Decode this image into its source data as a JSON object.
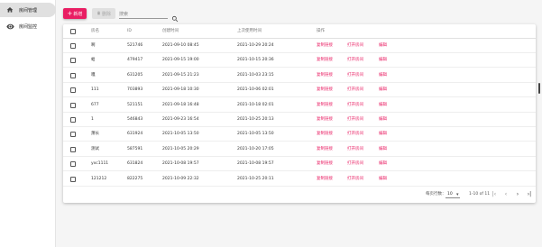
{
  "sidebar": {
    "items": [
      {
        "label": "房间管理",
        "icon": "home-icon",
        "active": true
      },
      {
        "label": "房间监控",
        "icon": "eye-icon",
        "active": false
      }
    ]
  },
  "toolbar": {
    "add_label": "新增",
    "delete_label": "删除",
    "search_placeholder": "搜索"
  },
  "table": {
    "headers": [
      "房名",
      "ID",
      "创建时间",
      "上次使用时间",
      "操作"
    ],
    "rows": [
      {
        "name": "啊",
        "id": "521746",
        "created": "2021-09-10 08:45",
        "last_used": "2021-10-29 20:24"
      },
      {
        "name": "蛤",
        "id": "479417",
        "created": "2021-09-15 19:00",
        "last_used": "2021-10-15 20:36"
      },
      {
        "name": "嘎",
        "id": "631205",
        "created": "2021-09-15 21:23",
        "last_used": "2021-10-03 23:15"
      },
      {
        "name": "111",
        "id": "703893",
        "created": "2021-09-18 10:30",
        "last_used": "2021-10-06 02:01"
      },
      {
        "name": "677",
        "id": "521151",
        "created": "2021-09-18 16:48",
        "last_used": "2021-10-18 02:01"
      },
      {
        "name": "1",
        "id": "546843",
        "created": "2021-09-23 16:54",
        "last_used": "2021-10-25 20:13"
      },
      {
        "name": "萧长",
        "id": "631924",
        "created": "2021-10-05 13:50",
        "last_used": "2021-10-05 13:50"
      },
      {
        "name": "测试",
        "id": "587591",
        "created": "2021-10-05 20:29",
        "last_used": "2021-10-20 17:05"
      },
      {
        "name": "yxc1111",
        "id": "631824",
        "created": "2021-10-08 19:57",
        "last_used": "2021-10-08 19:57"
      },
      {
        "name": "121212",
        "id": "822275",
        "created": "2021-10-09 22:32",
        "last_used": "2021-10-25 20:11"
      }
    ],
    "actions": [
      "复制链接",
      "打开房间",
      "编辑"
    ]
  },
  "pagination": {
    "rows_per_page_label": "每页行数：",
    "rows_per_page_value": "10",
    "range_text": "1-10 of 11"
  },
  "colors": {
    "accent": "#e91e63",
    "sidebar_active": "#e0e0e0"
  }
}
